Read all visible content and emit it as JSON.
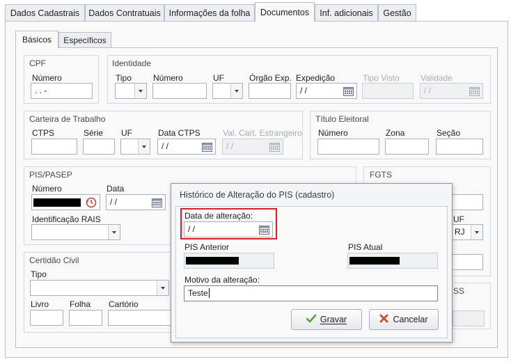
{
  "main_tabs": [
    "Dados Cadastrais",
    "Dados Contratuais",
    "Informações da folha",
    "Documentos",
    "Inf. adicionais",
    "Gestão"
  ],
  "sub_tabs": [
    "Básicos",
    "Específicos"
  ],
  "cpf": {
    "title": "CPF",
    "numero_label": "Número",
    "numero_value": " .  .  -"
  },
  "identidade": {
    "title": "Identidade",
    "tipo_label": "Tipo",
    "numero_label": "Número",
    "uf_label": "UF",
    "orgao_label": "Órgão Exp.",
    "expedicao_label": "Expedição",
    "expedicao_value": "/ /",
    "tipo_visto_label": "Tipo Visto",
    "validade_label": "Validade",
    "validade_value": "/ /"
  },
  "ctps": {
    "title": "Carteira de Trabalho",
    "ctps_label": "CTPS",
    "serie_label": "Série",
    "uf_label": "UF",
    "data_label": "Data CTPS",
    "data_value": "/ /",
    "val_label": "Val. Cart. Estrangeiro",
    "val_value": "/ /"
  },
  "titulo": {
    "title": "Título Eleitoral",
    "numero_label": "Número",
    "zona_label": "Zona",
    "secao_label": "Seção"
  },
  "pis": {
    "title": "PIS/PASEP",
    "numero_label": "Número",
    "data_label": "Data",
    "data_value": "/ /",
    "rais_label": "Identificação RAIS"
  },
  "fgts": {
    "title": "FGTS",
    "uf_label": "UF",
    "uf_value": "RJ",
    "partial_label": "SS"
  },
  "certidao": {
    "title": "Certidão Civil",
    "tipo_label": "Tipo",
    "livro_label": "Livro",
    "folha_label": "Folha",
    "cartorio_label": "Cartório"
  },
  "dialog": {
    "title": "Histórico de Alteração do PIS (cadastro)",
    "data_label": "Data de alteração:",
    "data_value": "/ /",
    "pis_anterior_label": "PIS Anterior",
    "pis_atual_label": "PIS Atual",
    "motivo_label": "Motivo da alteração:",
    "motivo_value": "Teste",
    "gravar_label": "Gravar",
    "cancelar_label": "Cancelar",
    "highlight_color": "#d7202a"
  }
}
